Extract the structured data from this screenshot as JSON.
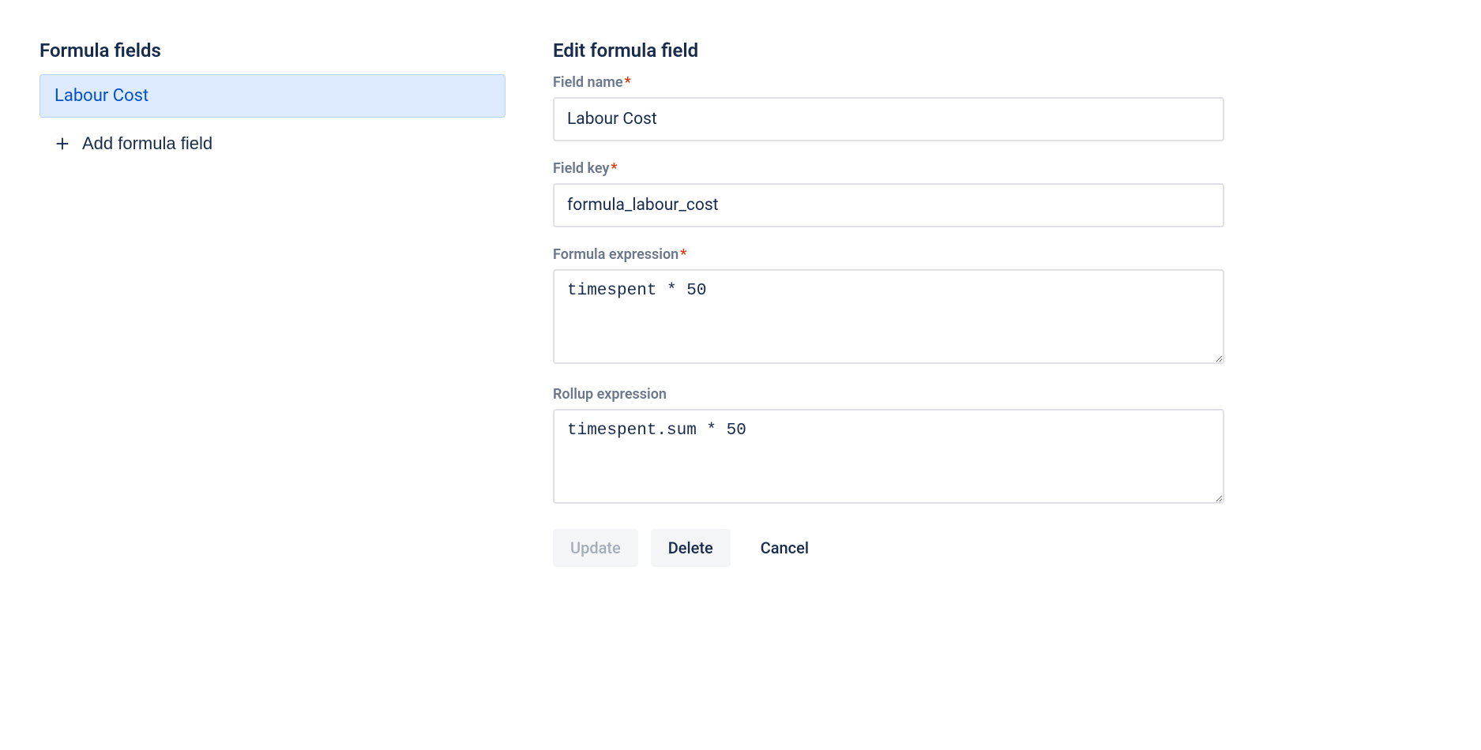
{
  "sidebar": {
    "heading": "Formula fields",
    "items": [
      {
        "label": "Labour Cost",
        "selected": true
      }
    ],
    "add_button_label": "Add formula field"
  },
  "form": {
    "heading": "Edit formula field",
    "fields": {
      "field_name": {
        "label": "Field name",
        "required": true,
        "value": "Labour Cost"
      },
      "field_key": {
        "label": "Field key",
        "required": true,
        "value": "formula_labour_cost"
      },
      "formula_expression": {
        "label": "Formula expression",
        "required": true,
        "value": "timespent * 50"
      },
      "rollup_expression": {
        "label": "Rollup expression",
        "required": false,
        "value": "timespent.sum * 50"
      }
    },
    "buttons": {
      "update": "Update",
      "delete": "Delete",
      "cancel": "Cancel"
    }
  }
}
